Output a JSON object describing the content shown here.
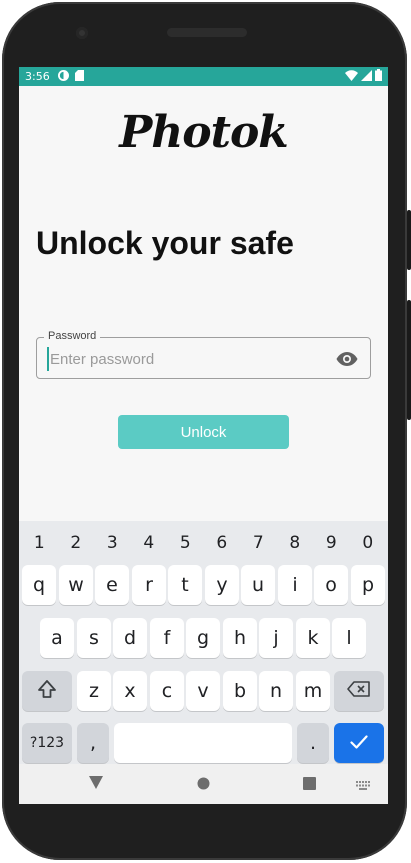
{
  "status_bar": {
    "time": "3:56",
    "bg_color": "#26a69a"
  },
  "app": {
    "logo_text": "Photok",
    "headline": "Unlock your safe",
    "password_field": {
      "label": "Password",
      "placeholder": "Enter password",
      "value": ""
    },
    "unlock_button_label": "Unlock",
    "accent_color": "#5bcbc4"
  },
  "keyboard": {
    "number_row": [
      "1",
      "2",
      "3",
      "4",
      "5",
      "6",
      "7",
      "8",
      "9",
      "0"
    ],
    "row1": [
      "q",
      "w",
      "e",
      "r",
      "t",
      "y",
      "u",
      "i",
      "o",
      "p"
    ],
    "row2": [
      "a",
      "s",
      "d",
      "f",
      "g",
      "h",
      "j",
      "k",
      "l"
    ],
    "row3": [
      "z",
      "x",
      "c",
      "v",
      "b",
      "n",
      "m"
    ],
    "symbols_label": "?123",
    "comma_label": ",",
    "period_label": ".",
    "shift_icon": "shift-icon",
    "backspace_icon": "backspace-icon",
    "enter_icon": "checkmark-icon"
  },
  "nav_bar": {
    "icons": [
      "back-icon",
      "home-icon",
      "recents-icon",
      "keyboard-switch-icon"
    ]
  }
}
